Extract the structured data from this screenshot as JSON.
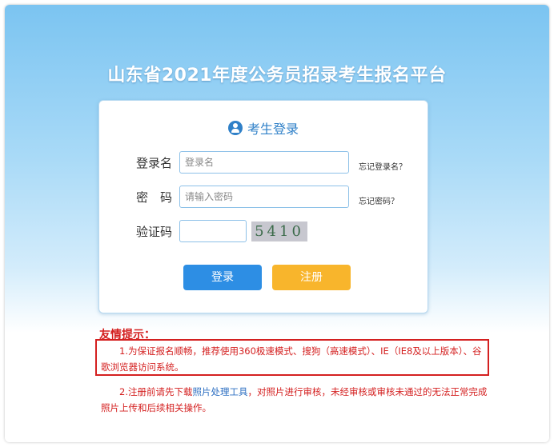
{
  "page": {
    "title": "山东省2021年度公务员招录考生报名平台"
  },
  "login": {
    "title": "考生登录",
    "icon": "user-icon",
    "username_label": "登录名",
    "username_placeholder": "登录名",
    "forgot_username": "忘记登录名？",
    "password_label": "密　码",
    "password_placeholder": "请输入密码",
    "forgot_password": "忘记密码？",
    "captcha_label": "验证码",
    "captcha_text": "5410",
    "login_button": "登录",
    "register_button": "注册"
  },
  "tips": {
    "title": "友情提示：",
    "tip1": "　　1.为保证报名顺畅，推荐使用360极速模式、搜狗（高速模式）、IE（IE8及以上版本）、谷歌浏览器访问系统。",
    "tip2_prefix": "　　2.注册前请先下载",
    "tip2_link": "照片处理工具",
    "tip2_suffix": "，对照片进行审核，未经审核或审核未通过的无法正常完成照片上传和后续相关操作。"
  },
  "colors": {
    "accent": "#2d8ee4",
    "register": "#f8b52c",
    "warning": "#d42020"
  }
}
